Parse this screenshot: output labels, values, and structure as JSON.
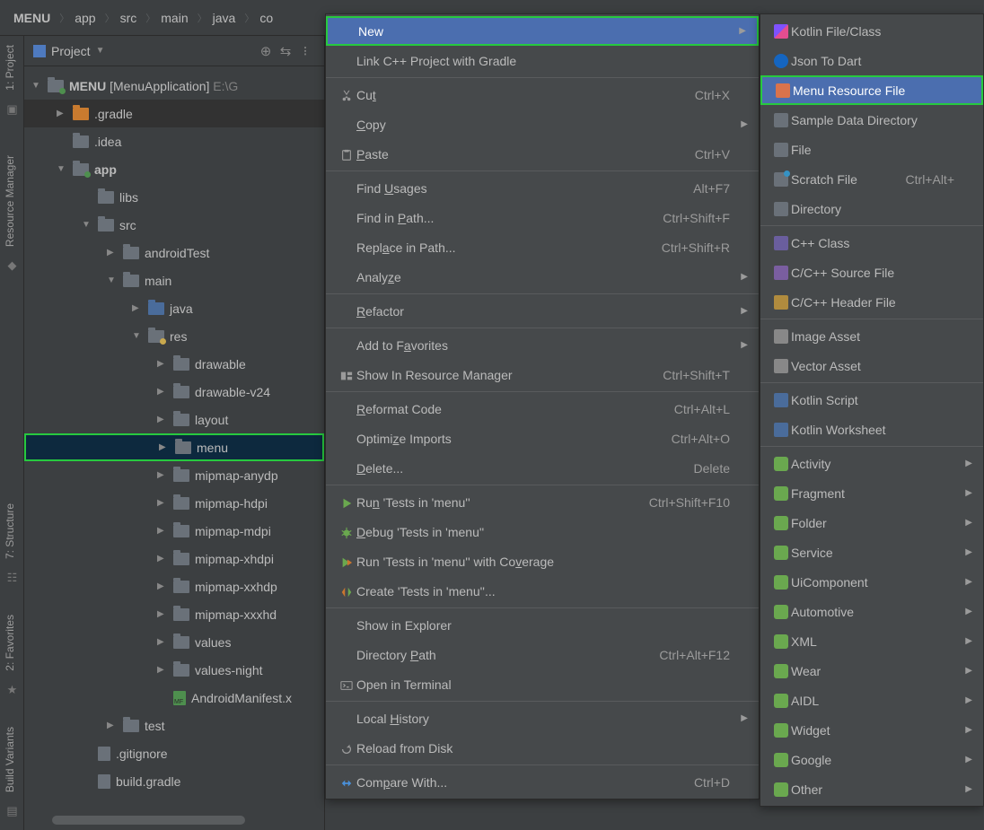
{
  "breadcrumb": [
    "MENU",
    "app",
    "src",
    "main",
    "java",
    "co"
  ],
  "project_header": {
    "title": "Project"
  },
  "vrail": {
    "project": "1: Project",
    "resmgr": "Resource Manager",
    "structure": "7: Structure",
    "favorites": "2: Favorites",
    "buildvar": "Build Variants"
  },
  "tree": [
    {
      "d": 0,
      "a": "open",
      "ic": "module",
      "txt": "MENU",
      "suf": " [MenuApplication]",
      "dim": "  E:\\G"
    },
    {
      "d": 1,
      "a": "closed",
      "ic": "orange",
      "txt": ".gradle",
      "hover": true
    },
    {
      "d": 1,
      "a": "none",
      "ic": "folder",
      "txt": ".idea"
    },
    {
      "d": 1,
      "a": "open",
      "ic": "module",
      "txt": "app",
      "bold": true
    },
    {
      "d": 2,
      "a": "none",
      "ic": "folder",
      "txt": "libs"
    },
    {
      "d": 2,
      "a": "open",
      "ic": "folder",
      "txt": "src"
    },
    {
      "d": 3,
      "a": "closed",
      "ic": "folder",
      "txt": "androidTest"
    },
    {
      "d": 3,
      "a": "open",
      "ic": "folder",
      "txt": "main"
    },
    {
      "d": 4,
      "a": "closed",
      "ic": "blue",
      "txt": "java"
    },
    {
      "d": 4,
      "a": "open",
      "ic": "resdir",
      "txt": "res"
    },
    {
      "d": 5,
      "a": "closed",
      "ic": "folder",
      "txt": "drawable"
    },
    {
      "d": 5,
      "a": "closed",
      "ic": "folder",
      "txt": "drawable-v24"
    },
    {
      "d": 5,
      "a": "closed",
      "ic": "folder",
      "txt": "layout"
    },
    {
      "d": 5,
      "a": "closed",
      "ic": "folder",
      "txt": "menu",
      "sel": true
    },
    {
      "d": 5,
      "a": "closed",
      "ic": "folder",
      "txt": "mipmap-anydp"
    },
    {
      "d": 5,
      "a": "closed",
      "ic": "folder",
      "txt": "mipmap-hdpi"
    },
    {
      "d": 5,
      "a": "closed",
      "ic": "folder",
      "txt": "mipmap-mdpi"
    },
    {
      "d": 5,
      "a": "closed",
      "ic": "folder",
      "txt": "mipmap-xhdpi"
    },
    {
      "d": 5,
      "a": "closed",
      "ic": "folder",
      "txt": "mipmap-xxhdp"
    },
    {
      "d": 5,
      "a": "closed",
      "ic": "folder",
      "txt": "mipmap-xxxhd"
    },
    {
      "d": 5,
      "a": "closed",
      "ic": "folder",
      "txt": "values"
    },
    {
      "d": 5,
      "a": "closed",
      "ic": "folder",
      "txt": "values-night"
    },
    {
      "d": 5,
      "a": "none",
      "ic": "mf",
      "txt": "AndroidManifest.x"
    },
    {
      "d": 3,
      "a": "closed",
      "ic": "folder",
      "txt": "test"
    },
    {
      "d": 2,
      "a": "none",
      "ic": "file",
      "txt": ".gitignore"
    },
    {
      "d": 2,
      "a": "none",
      "ic": "file",
      "txt": "build.gradle"
    }
  ],
  "menu1": [
    {
      "t": "item",
      "hi": true,
      "label": "New",
      "sub": true
    },
    {
      "t": "item",
      "label": "Link C++ Project with Gradle"
    },
    {
      "t": "sep"
    },
    {
      "t": "item",
      "icon": "cut",
      "label": "Cu_t",
      "key": "Ctrl+X"
    },
    {
      "t": "item",
      "label": "_Copy",
      "sub": true
    },
    {
      "t": "item",
      "icon": "paste",
      "label": "_Paste",
      "key": "Ctrl+V"
    },
    {
      "t": "sep"
    },
    {
      "t": "item",
      "label": "Find _Usages",
      "key": "Alt+F7"
    },
    {
      "t": "item",
      "label": "Find in _Path...",
      "key": "Ctrl+Shift+F"
    },
    {
      "t": "item",
      "label": "Repl_ace in Path...",
      "key": "Ctrl+Shift+R"
    },
    {
      "t": "item",
      "label": "Analy_ze",
      "sub": true
    },
    {
      "t": "sep"
    },
    {
      "t": "item",
      "label": "_Refactor",
      "sub": true
    },
    {
      "t": "sep"
    },
    {
      "t": "item",
      "label": "Add to F_avorites",
      "sub": true
    },
    {
      "t": "item",
      "icon": "resmgr",
      "label": "Show In Resource Manager",
      "key": "Ctrl+Shift+T"
    },
    {
      "t": "sep"
    },
    {
      "t": "item",
      "label": "_Reformat Code",
      "key": "Ctrl+Alt+L"
    },
    {
      "t": "item",
      "label": "Optimi_ze Imports",
      "key": "Ctrl+Alt+O"
    },
    {
      "t": "item",
      "label": "_Delete...",
      "key": "Delete"
    },
    {
      "t": "sep"
    },
    {
      "t": "item",
      "icon": "run",
      "label": "Ru_n 'Tests in 'menu''",
      "key": "Ctrl+Shift+F10"
    },
    {
      "t": "item",
      "icon": "debug",
      "label": "_Debug 'Tests in 'menu''"
    },
    {
      "t": "item",
      "icon": "cov",
      "label": "Run 'Tests in 'menu'' with Co_verage"
    },
    {
      "t": "item",
      "icon": "create",
      "label": "Create 'Tests in 'menu''..."
    },
    {
      "t": "sep"
    },
    {
      "t": "item",
      "label": "Show in Explorer"
    },
    {
      "t": "item",
      "label": "Directory _Path",
      "key": "Ctrl+Alt+F12"
    },
    {
      "t": "item",
      "icon": "term",
      "label": "Open in Terminal"
    },
    {
      "t": "sep"
    },
    {
      "t": "item",
      "label": "Local _History",
      "sub": true
    },
    {
      "t": "item",
      "icon": "reload",
      "label": "Reload from Disk"
    },
    {
      "t": "sep"
    },
    {
      "t": "item",
      "icon": "compare",
      "label": "Com_pare With...",
      "key": "Ctrl+D"
    }
  ],
  "menu2": [
    {
      "ic": "kt",
      "label": "Kotlin File/Class"
    },
    {
      "ic": "jd",
      "label": "Json To Dart"
    },
    {
      "ic": "mr",
      "label": "Menu Resource File",
      "hi": true
    },
    {
      "ic": "dir",
      "label": "Sample Data Directory"
    },
    {
      "ic": "file",
      "label": "File"
    },
    {
      "ic": "sc",
      "label": "Scratch File",
      "key": "Ctrl+Alt+"
    },
    {
      "ic": "dir",
      "label": "Directory"
    },
    {
      "t": "sep"
    },
    {
      "ic": "s",
      "label": "C++ Class"
    },
    {
      "ic": "cppf",
      "label": "C/C++ Source File"
    },
    {
      "ic": "cpph",
      "label": "C/C++ Header File"
    },
    {
      "t": "sep"
    },
    {
      "ic": "img",
      "label": "Image Asset"
    },
    {
      "ic": "vec",
      "label": "Vector Asset"
    },
    {
      "t": "sep"
    },
    {
      "ic": "kts",
      "label": "Kotlin Script"
    },
    {
      "ic": "ktw",
      "label": "Kotlin Worksheet"
    },
    {
      "t": "sep"
    },
    {
      "ic": "and",
      "label": "Activity",
      "sub": true
    },
    {
      "ic": "and",
      "label": "Fragment",
      "sub": true
    },
    {
      "ic": "and",
      "label": "Folder",
      "sub": true
    },
    {
      "ic": "and",
      "label": "Service",
      "sub": true
    },
    {
      "ic": "and",
      "label": "UiComponent",
      "sub": true
    },
    {
      "ic": "and",
      "label": "Automotive",
      "sub": true
    },
    {
      "ic": "and",
      "label": "XML",
      "sub": true
    },
    {
      "ic": "and",
      "label": "Wear",
      "sub": true
    },
    {
      "ic": "and",
      "label": "AIDL",
      "sub": true
    },
    {
      "ic": "and",
      "label": "Widget",
      "sub": true
    },
    {
      "ic": "and",
      "label": "Google",
      "sub": true
    },
    {
      "ic": "and",
      "label": "Other",
      "sub": true
    }
  ]
}
